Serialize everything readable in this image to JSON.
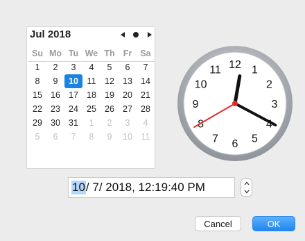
{
  "calendar": {
    "month_title": "Jul 2018",
    "nav_icons": {
      "prev": "triangle-left-icon",
      "today": "dot-icon",
      "next": "triangle-right-icon"
    },
    "weekdays": [
      "Su",
      "Mo",
      "Tu",
      "We",
      "Th",
      "Fr",
      "Sa"
    ],
    "selected_day": "10",
    "weeks": [
      [
        {
          "d": "1",
          "m": "cur"
        },
        {
          "d": "2",
          "m": "cur"
        },
        {
          "d": "3",
          "m": "cur"
        },
        {
          "d": "4",
          "m": "cur"
        },
        {
          "d": "5",
          "m": "cur"
        },
        {
          "d": "6",
          "m": "cur"
        },
        {
          "d": "7",
          "m": "cur"
        }
      ],
      [
        {
          "d": "8",
          "m": "cur"
        },
        {
          "d": "9",
          "m": "cur"
        },
        {
          "d": "10",
          "m": "sel"
        },
        {
          "d": "11",
          "m": "cur"
        },
        {
          "d": "12",
          "m": "cur"
        },
        {
          "d": "13",
          "m": "cur"
        },
        {
          "d": "14",
          "m": "cur"
        }
      ],
      [
        {
          "d": "15",
          "m": "cur"
        },
        {
          "d": "16",
          "m": "cur"
        },
        {
          "d": "17",
          "m": "cur"
        },
        {
          "d": "18",
          "m": "cur"
        },
        {
          "d": "19",
          "m": "cur"
        },
        {
          "d": "20",
          "m": "cur"
        },
        {
          "d": "21",
          "m": "cur"
        }
      ],
      [
        {
          "d": "22",
          "m": "cur"
        },
        {
          "d": "23",
          "m": "cur"
        },
        {
          "d": "24",
          "m": "cur"
        },
        {
          "d": "25",
          "m": "cur"
        },
        {
          "d": "26",
          "m": "cur"
        },
        {
          "d": "27",
          "m": "cur"
        },
        {
          "d": "28",
          "m": "cur"
        }
      ],
      [
        {
          "d": "29",
          "m": "cur"
        },
        {
          "d": "30",
          "m": "cur"
        },
        {
          "d": "31",
          "m": "cur"
        },
        {
          "d": "1",
          "m": "other"
        },
        {
          "d": "2",
          "m": "other"
        },
        {
          "d": "3",
          "m": "other"
        },
        {
          "d": "4",
          "m": "other"
        }
      ],
      [
        {
          "d": "5",
          "m": "other"
        },
        {
          "d": "6",
          "m": "other"
        },
        {
          "d": "7",
          "m": "other"
        },
        {
          "d": "8",
          "m": "other"
        },
        {
          "d": "9",
          "m": "other"
        },
        {
          "d": "10",
          "m": "other"
        },
        {
          "d": "11",
          "m": "other"
        }
      ]
    ]
  },
  "clock": {
    "numerals": [
      "12",
      "1",
      "2",
      "3",
      "4",
      "5",
      "6",
      "7",
      "8",
      "9",
      "10",
      "11"
    ],
    "hours": 12,
    "minutes": 19,
    "seconds": 40,
    "colors": {
      "second_hand": "#e32b2b",
      "rim": "#9ea3a8",
      "face": "#ffffff"
    }
  },
  "datetime_field": {
    "month": "10",
    "rest": "/ 7/ 2018, 12:19:40 PM"
  },
  "stepper": {
    "up_icon": "chevron-up-icon",
    "down_icon": "chevron-down-icon"
  },
  "buttons": {
    "cancel": "Cancel",
    "ok": "OK"
  },
  "colors": {
    "accent": "#1a82e2",
    "field_highlight": "#b4d7fb",
    "background": "#ececec"
  }
}
